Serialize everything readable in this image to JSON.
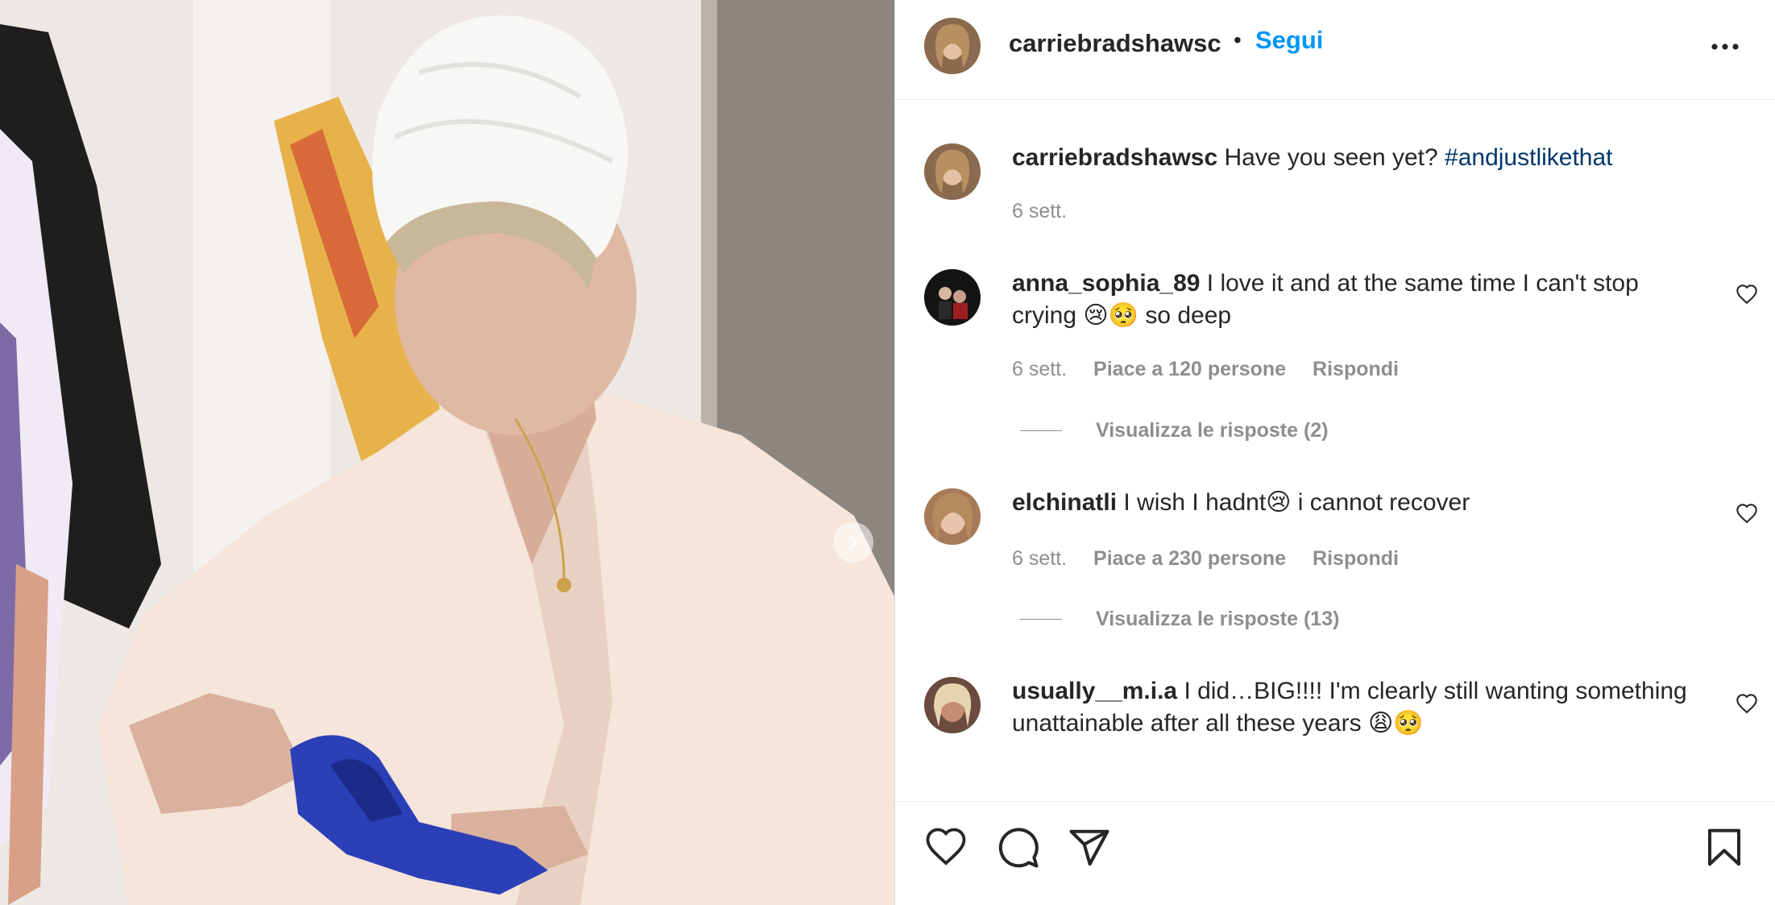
{
  "post": {
    "author": "carriebradshawsc",
    "separator": "•",
    "follow_label": "Segui"
  },
  "icons": {
    "more": "more-options-icon",
    "next": "chevron-right-icon",
    "like": "heart-icon",
    "comment": "comment-bubble-icon",
    "share": "paper-plane-icon",
    "save": "bookmark-icon"
  },
  "caption": {
    "username": "carriebradshawsc",
    "text": "Have you seen yet?",
    "hashtag": "#andjustlikethat",
    "time": "6 sett."
  },
  "comments": [
    {
      "username": "anna_sophia_89",
      "text": "I love it and at the same time I can't stop crying 😢🥺 so deep",
      "time": "6 sett.",
      "likes": "Piace a 120 persone",
      "reply": "Rispondi",
      "view_replies": "Visualizza le risposte (2)"
    },
    {
      "username": "elchinatli",
      "text": "I wish I hadnt😢 i cannot recover",
      "time": "6 sett.",
      "likes": "Piace a 230 persone",
      "reply": "Rispondi",
      "view_replies": "Visualizza le risposte (13)"
    },
    {
      "username": "usually__m.i.a",
      "text": "I did…BIG!!!! I'm clearly still wanting something unattainable after all these years 😩🥺"
    }
  ],
  "colors": {
    "accent": "#0095f6",
    "hashtag": "#00376b",
    "muted": "#8e8e8e",
    "text": "#262626"
  }
}
